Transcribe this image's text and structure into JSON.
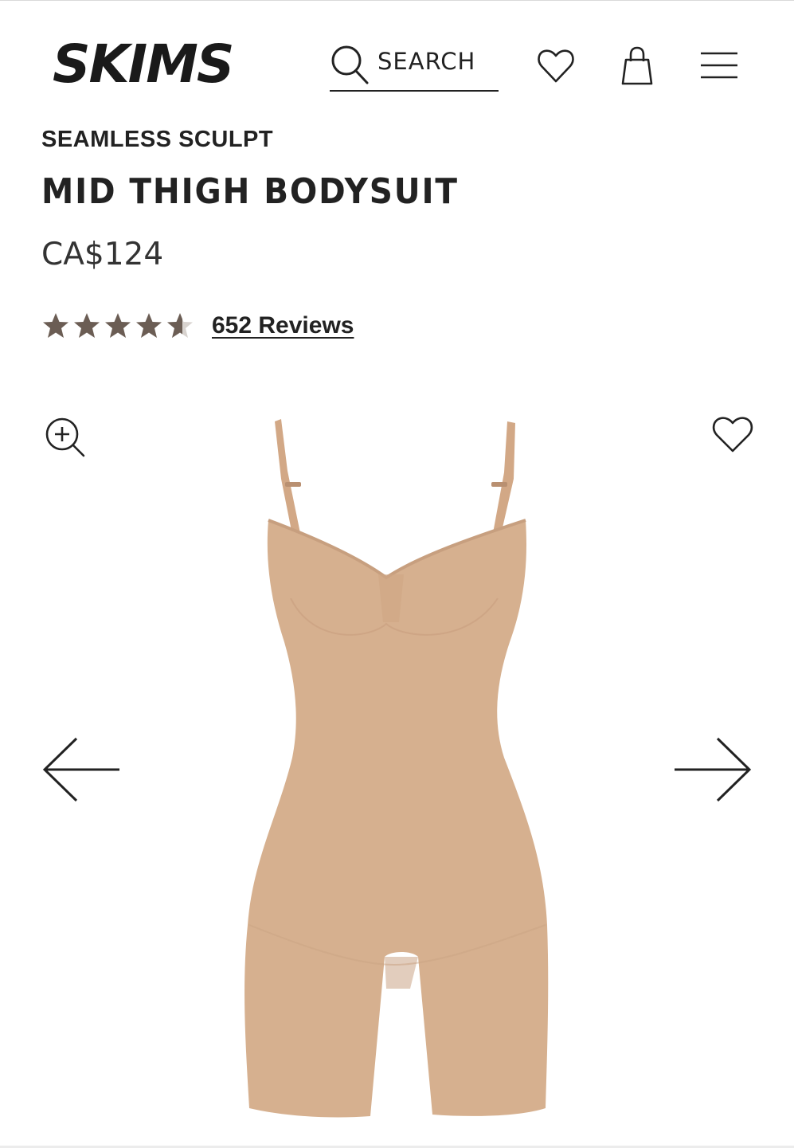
{
  "header": {
    "brand": "SKIMS",
    "search_label": "SEARCH",
    "icons": [
      "search-icon",
      "heart-icon",
      "shopping-bag-icon",
      "hamburger-menu-icon"
    ]
  },
  "product": {
    "collection": "SEAMLESS SCULPT",
    "name": "MID THIGH BODYSUIT",
    "price": "CA$124",
    "rating": 4.5,
    "rating_max": 5,
    "reviews_label": "652 Reviews"
  },
  "gallery": {
    "icons": [
      "zoom-in-icon",
      "heart-icon",
      "arrow-left-icon",
      "arrow-right-icon"
    ]
  },
  "colors": {
    "text": "#222222",
    "star": "#6b5d54",
    "product": "#d6b08f",
    "background": "#ffffff"
  }
}
